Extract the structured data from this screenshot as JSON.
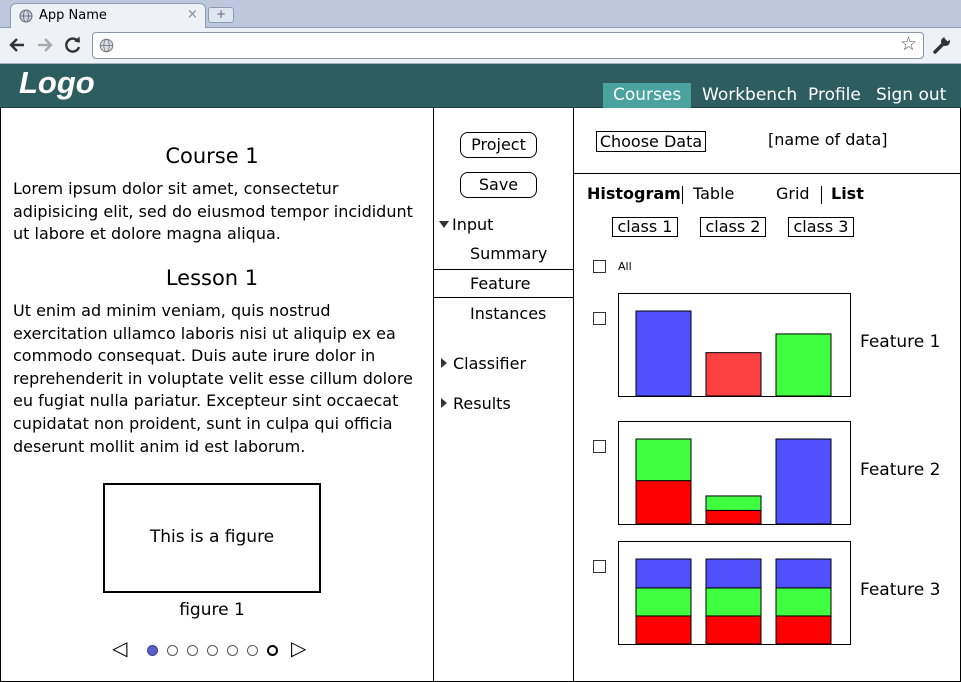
{
  "browser": {
    "tab_title": "App Name",
    "tab_close": "×",
    "new_tab": "+",
    "url": ""
  },
  "header": {
    "logo": "Logo",
    "nav": [
      {
        "label": "Courses",
        "active": true
      },
      {
        "label": "Workbench",
        "active": false
      },
      {
        "label": "Profile",
        "active": false
      },
      {
        "label": "Sign out",
        "active": false
      }
    ]
  },
  "lesson_panel": {
    "course_title": "Course 1",
    "course_text": "Lorem ipsum dolor sit amet, consectetur adipisicing elit, sed do eiusmod tempor incididunt ut labore et dolore magna aliqua.",
    "lesson_title": "Lesson 1",
    "lesson_text": "Ut enim ad minim veniam, quis nostrud exercitation ullamco laboris nisi ut aliquip ex ea commodo consequat. Duis aute irure dolor in reprehenderit in voluptate velit esse cillum dolore eu fugiat nulla pariatur. Excepteur sint occaecat cupidatat non proident, sunt in culpa qui officia deserunt mollit anim id est laborum.",
    "figure_text": "This is a figure",
    "figure_caption": "figure 1",
    "pager": {
      "prev": "◁",
      "next": "▷",
      "page_count": 7,
      "current_page": 1
    }
  },
  "workbench_nav": {
    "project_button": "Project",
    "save_button": "Save",
    "tree": {
      "input": "Input",
      "summary": "Summary",
      "feature": "Feature",
      "instances": "Instances",
      "classifier": "Classifier",
      "results": "Results"
    },
    "selected": "Feature"
  },
  "data_view": {
    "choose_data_button": "Choose Data",
    "data_name": "[name of data]",
    "view_tabs": [
      "Histogram",
      "Table",
      "Grid",
      "List"
    ],
    "classes": [
      "class 1",
      "class 2",
      "class 3"
    ],
    "all_label": "All",
    "colors": {
      "class_blue": "#5050ff",
      "class_red": "#ff4040",
      "class_green": "#40ff40",
      "stack_red": "#ff0000"
    },
    "features": [
      {
        "label": "Feature 1"
      },
      {
        "label": "Feature 2"
      },
      {
        "label": "Feature 3"
      }
    ]
  },
  "chart_data": [
    {
      "type": "bar",
      "title": "Feature 1",
      "categories": [
        "",
        "",
        ""
      ],
      "series": [
        {
          "values": [
            1.0,
            0.51,
            0.73
          ]
        }
      ],
      "colors": [
        "#5050ff",
        "#ff4040",
        "#40ff40"
      ],
      "ylim": [
        0,
        1
      ],
      "grid": false
    },
    {
      "type": "bar",
      "title": "Feature 2",
      "categories": [
        "",
        "",
        ""
      ],
      "stacked": true,
      "series": [
        {
          "values": [
            0.51,
            0.16,
            0.0
          ],
          "color": "#ff0000"
        },
        {
          "values": [
            0.49,
            0.17,
            0.0
          ],
          "color": "#40ff40"
        },
        {
          "values": [
            0.0,
            0.0,
            1.0
          ],
          "color": "#5050ff"
        }
      ],
      "ylim": [
        0,
        1
      ],
      "grid": false
    },
    {
      "type": "bar",
      "title": "Feature 3",
      "categories": [
        "",
        "",
        ""
      ],
      "stacked": true,
      "series": [
        {
          "values": [
            0.33,
            0.33,
            0.33
          ],
          "color": "#ff0000"
        },
        {
          "values": [
            0.33,
            0.33,
            0.33
          ],
          "color": "#40ff40"
        },
        {
          "values": [
            0.34,
            0.34,
            0.34
          ],
          "color": "#5050ff"
        }
      ],
      "ylim": [
        0,
        1
      ],
      "grid": false
    }
  ]
}
